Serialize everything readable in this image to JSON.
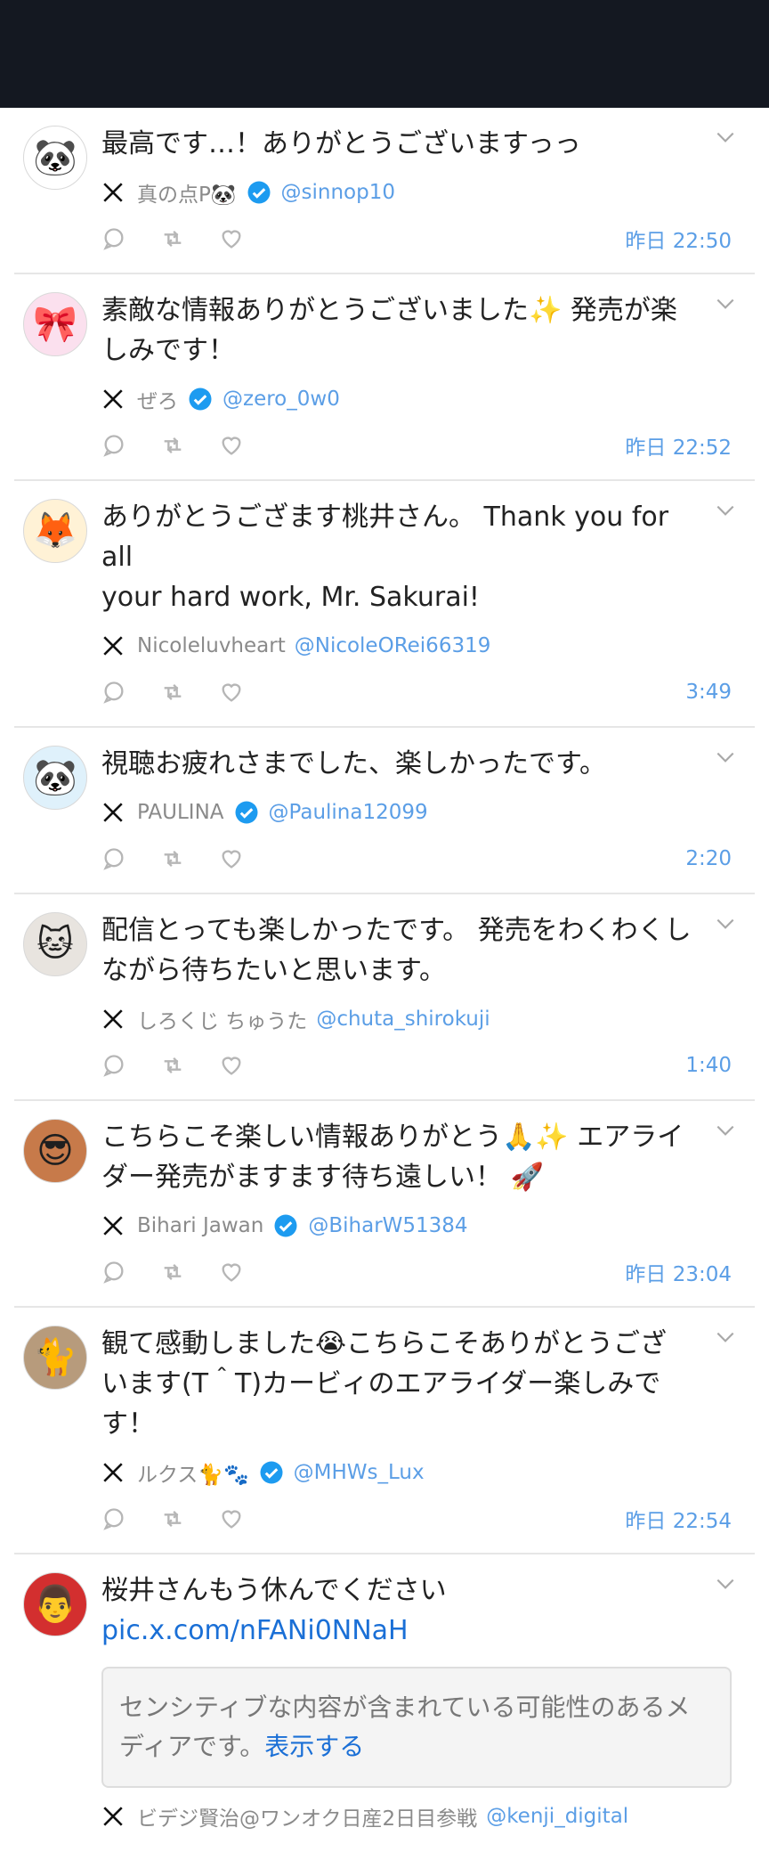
{
  "posts": [
    {
      "text": "最高です…！ありがとうございますっっ",
      "name": "真の点P🐼",
      "verified": true,
      "handle": "@sinnop10",
      "time": "昨日 22:50",
      "avatar": "🐼",
      "avatar_bg": "#ffffff"
    },
    {
      "text": "素敵な情報ありがとうございました✨ 発売が楽\nしみです！",
      "name": "ぜろ",
      "verified": true,
      "handle": "@zero_0w0",
      "time": "昨日 22:52",
      "avatar": "🎀",
      "avatar_bg": "#fbe0ee"
    },
    {
      "text": "ありがとうござます桃井さん。 Thank you for all\nyour hard work, Mr. Sakurai!",
      "name": "Nicoleluvheart",
      "verified": false,
      "handle": "@NicoleORei66319",
      "time": "3:49",
      "avatar": "🦊",
      "avatar_bg": "#fff2d6"
    },
    {
      "text": "視聴お疲れさまでした、楽しかったです。",
      "name": "PAULINA",
      "verified": true,
      "handle": "@Paulina12099",
      "time": "2:20",
      "avatar": "🐼",
      "avatar_bg": "#dff1fb"
    },
    {
      "text": "配信とっても楽しかったです。 発売をわくわくし\nながら待ちたいと思います。",
      "name": "しろくじ ちゅうた",
      "verified": false,
      "handle": "@chuta_shirokuji",
      "time": "1:40",
      "avatar": "🐱",
      "avatar_bg": "#e8e4df"
    },
    {
      "text": "こちらこそ楽しい情報ありがとう🙏✨ エアライ\nダー発売がますます待ち遠しい！ 🚀",
      "name": "Bihari Jawan",
      "verified": true,
      "handle": "@BiharW51384",
      "time": "昨日 23:04",
      "avatar": "😎",
      "avatar_bg": "#c77a4a"
    },
    {
      "text": "観て感動しました😭こちらこそありがとうござ\nいます(T＾T)カービィのエアライダー楽しみで\nす！",
      "name": "ルクス🐈🐾",
      "verified": true,
      "handle": "@MHWs_Lux",
      "time": "昨日 22:54",
      "avatar": "🐈",
      "avatar_bg": "#b79b7c"
    },
    {
      "text": "桜井さんもう休んでください",
      "link": "pic.x.com/nFANi0NNaH",
      "sensitive_text": "センシティブな内容が含まれている可能性のあるメディアです。",
      "sensitive_action": "表示する",
      "name": "ビデジ賢治@ワンオク日産2日目参戦",
      "verified": false,
      "handle": "@kenji_digital",
      "avatar": "👨",
      "avatar_bg": "#d32f2f"
    }
  ],
  "colors": {
    "topbar": "#141821",
    "accent": "#5b9ee6",
    "link": "#1a6fd6",
    "verified": "#1d9bf0"
  }
}
